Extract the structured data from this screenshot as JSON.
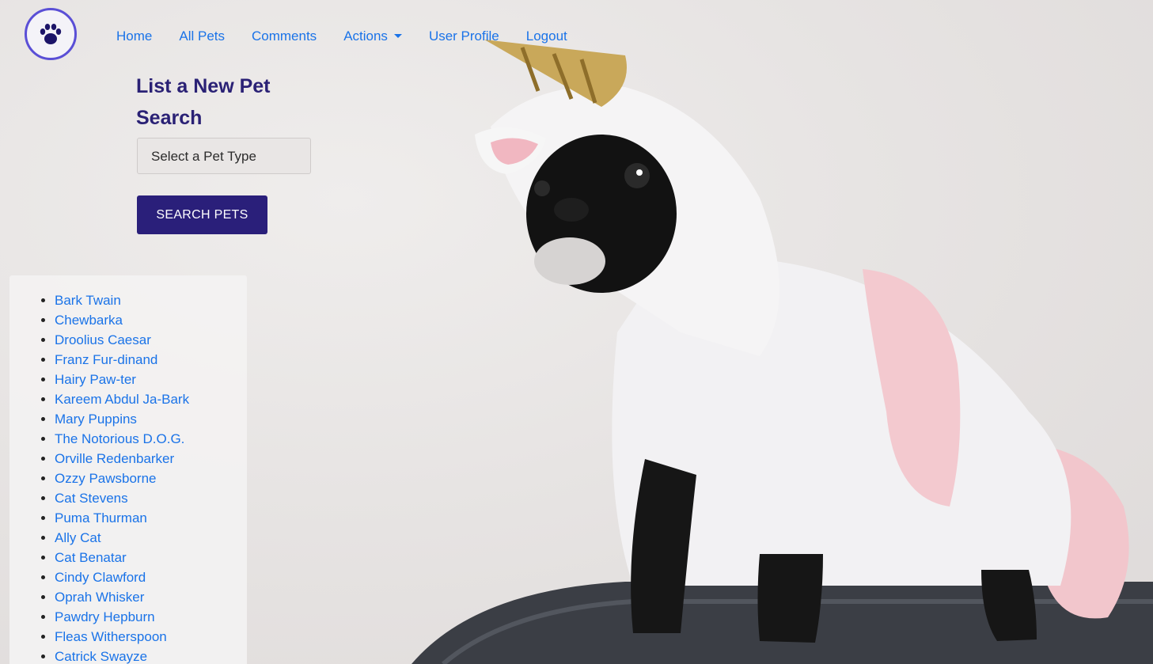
{
  "nav": {
    "logo_icon": "paw-icon",
    "links": [
      "Home",
      "All Pets",
      "Comments",
      "Actions",
      "User Profile",
      "Logout"
    ]
  },
  "main": {
    "list_new_pet": "List a New Pet",
    "search_heading": "Search",
    "pet_type_select": "Select a Pet Type",
    "search_button": "SEARCH PETS"
  },
  "pets": [
    "Bark Twain",
    "Chewbarka",
    "Droolius Caesar",
    "Franz Fur-dinand",
    "Hairy Paw-ter",
    "Kareem Abdul Ja-Bark",
    "Mary Puppins",
    "The Notorious D.O.G.",
    "Orville Redenbarker",
    "Ozzy Pawsborne",
    "Cat Stevens",
    "Puma Thurman",
    "Ally Cat",
    "Cat Benatar",
    "Cindy Clawford",
    "Oprah Whisker",
    "Pawdry Hepburn",
    "Fleas Witherspoon",
    "Catrick Swayze"
  ],
  "colors": {
    "link": "#1a73e8",
    "heading": "#2a2175",
    "button": "#2a1f7a",
    "logo_ring": "#5a4fd6"
  }
}
